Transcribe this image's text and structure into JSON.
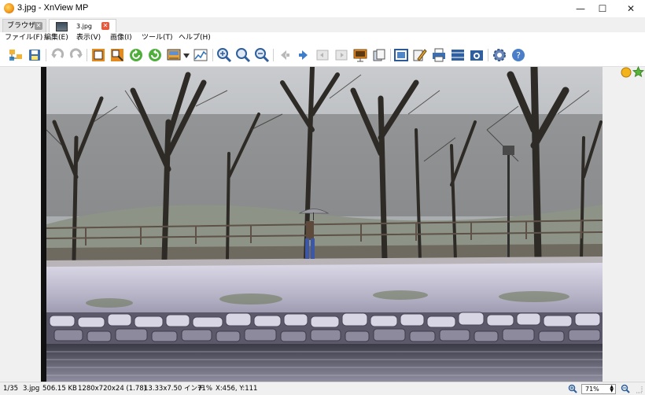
{
  "window": {
    "title": "3.jpg - XnView MP",
    "minimize_symbol": "—",
    "maximize_symbol": "☐",
    "close_symbol": "✕"
  },
  "tabs": [
    {
      "label": "ブラウザ",
      "active": false
    },
    {
      "label": "3.jpg",
      "active": true
    }
  ],
  "menu": [
    {
      "label": "ファイル(F)"
    },
    {
      "label": "編集(E)"
    },
    {
      "label": "表示(V)"
    },
    {
      "label": "画像(I)"
    },
    {
      "label": "ツール(T)"
    },
    {
      "label": "ヘルプ(H)"
    }
  ],
  "toolbar": {
    "icons": [
      "browser-icon",
      "save-icon",
      "undo-icon",
      "redo-icon",
      "crop-icon",
      "resize-icon",
      "rotate-left-icon",
      "rotate-right-icon",
      "adjust-icon",
      "levels-icon",
      "zoom-in-icon",
      "zoom-fit-icon",
      "zoom-out-icon",
      "previous-icon",
      "next-icon",
      "first-icon",
      "last-icon",
      "slideshow-icon",
      "compare-icon",
      "fullscreen-icon",
      "edit-icon",
      "print-icon",
      "filmstrip-icon",
      "capture-icon",
      "settings-icon",
      "help-icon"
    ]
  },
  "status": {
    "index": "1/35",
    "filename": "3.jpg",
    "filesize": "506.15 KB",
    "dimensions": "1280x720x24 (1.78)",
    "print_size": "13.33x7.50 インチ",
    "zoom_percent": "71%",
    "coords": "X:456, Y:111",
    "zoom_field": "71%"
  },
  "colors": {
    "tab_close": "#e8583a",
    "tab_close_inactive": "#9a9a9a",
    "viewer_bg": "#f0f0f0"
  }
}
